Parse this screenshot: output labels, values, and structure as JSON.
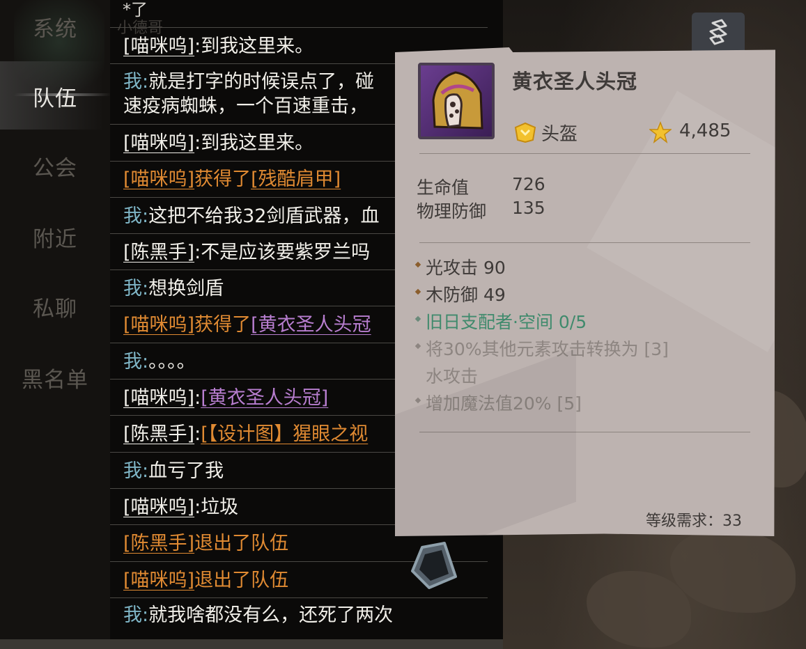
{
  "sidebar": {
    "items": [
      {
        "label": "系统",
        "active": false
      },
      {
        "label": "队伍",
        "active": true
      },
      {
        "label": "公会",
        "active": false
      },
      {
        "label": "附近",
        "active": false
      },
      {
        "label": "私聊",
        "active": false
      },
      {
        "label": "黑名单",
        "active": false
      }
    ]
  },
  "chat": {
    "top_fragment": "*了",
    "top_faded": "小德哥",
    "messages": [
      {
        "speaker": "[喵咪呜]",
        "sep": ":",
        "text": "到我这里来。",
        "line2": "",
        "kind": "player"
      },
      {
        "speaker": "我",
        "sep": ":",
        "text": "就是打字的时候误点了，碰",
        "line2": "速疫病蜘蛛，一个百速重击，",
        "kind": "me"
      },
      {
        "speaker": "[喵咪呜]",
        "sep": ":",
        "text": "到我这里来。",
        "line2": "",
        "kind": "player"
      },
      {
        "speaker": "[喵咪呜]",
        "sep": "",
        "text": "获得了",
        "item": "[残酷肩甲]",
        "line2": "",
        "kind": "loot-orange"
      },
      {
        "speaker": "我",
        "sep": ":",
        "text": "这把不给我32剑盾武器，血",
        "line2": "",
        "kind": "me"
      },
      {
        "speaker": "[陈黑手]",
        "sep": ":",
        "text": "不是应该要紫罗兰吗",
        "line2": "",
        "kind": "player"
      },
      {
        "speaker": "我",
        "sep": ":",
        "text": "想换剑盾",
        "line2": "",
        "kind": "me"
      },
      {
        "speaker": "[喵咪呜]",
        "sep": "",
        "text": "获得了",
        "item": "[黄衣圣人头冠",
        "line2": "",
        "kind": "loot-purple"
      },
      {
        "speaker": "我",
        "sep": ":",
        "text": "。。。。",
        "line2": "",
        "kind": "me"
      },
      {
        "speaker": "[喵咪呜]",
        "sep": ":",
        "text": "",
        "item": "[黄衣圣人头冠]",
        "line2": "",
        "kind": "link-purple"
      },
      {
        "speaker": "[陈黑手]",
        "sep": ":",
        "text": "",
        "item": "[【设计图】猩眼之视",
        "line2": "",
        "kind": "link-orange"
      },
      {
        "speaker": "我",
        "sep": ":",
        "text": "血亏了我",
        "line2": "",
        "kind": "me"
      },
      {
        "speaker": "[喵咪呜]",
        "sep": ":",
        "text": "垃圾",
        "line2": "",
        "kind": "player"
      },
      {
        "speaker": "[陈黑手]",
        "sep": "",
        "text": "退出了队伍",
        "line2": "",
        "kind": "system"
      },
      {
        "speaker": "[喵咪呜]",
        "sep": "",
        "text": "退出了队伍",
        "line2": "",
        "kind": "system"
      },
      {
        "speaker": "我",
        "sep": ":",
        "text": "就我啥都没有么，还死了两次",
        "line2": "",
        "kind": "me"
      }
    ]
  },
  "tooltip": {
    "item_name": "黄衣圣人头冠",
    "item_icon": "hooded-mask-helmet-icon",
    "type": "头盔",
    "type_icon": "helmet-type-icon",
    "score_icon": "star-icon",
    "score": "4,485",
    "base_stats": [
      {
        "name": "生命值",
        "value": "726"
      },
      {
        "name": "物理防御",
        "value": "135"
      }
    ],
    "attributes": [
      {
        "text": "光攻击 90",
        "style": "normal"
      },
      {
        "text": "木防御 49",
        "style": "normal"
      },
      {
        "text": "旧日支配者·空间 0/5",
        "style": "set"
      },
      {
        "text": "将30%其他元素攻击转换为  [3]",
        "style": "inactive"
      },
      {
        "text": "水攻击",
        "style": "inactive-cont"
      },
      {
        "text": "增加魔法值20% [5]",
        "style": "inactive"
      }
    ],
    "level_req": "等级需求：33"
  },
  "colors": {
    "me": "#7fb6c7",
    "orange": "#e08a32",
    "purple": "#b87ed0",
    "set_green": "#3f8a6c",
    "panel": "#bdb3b0"
  }
}
